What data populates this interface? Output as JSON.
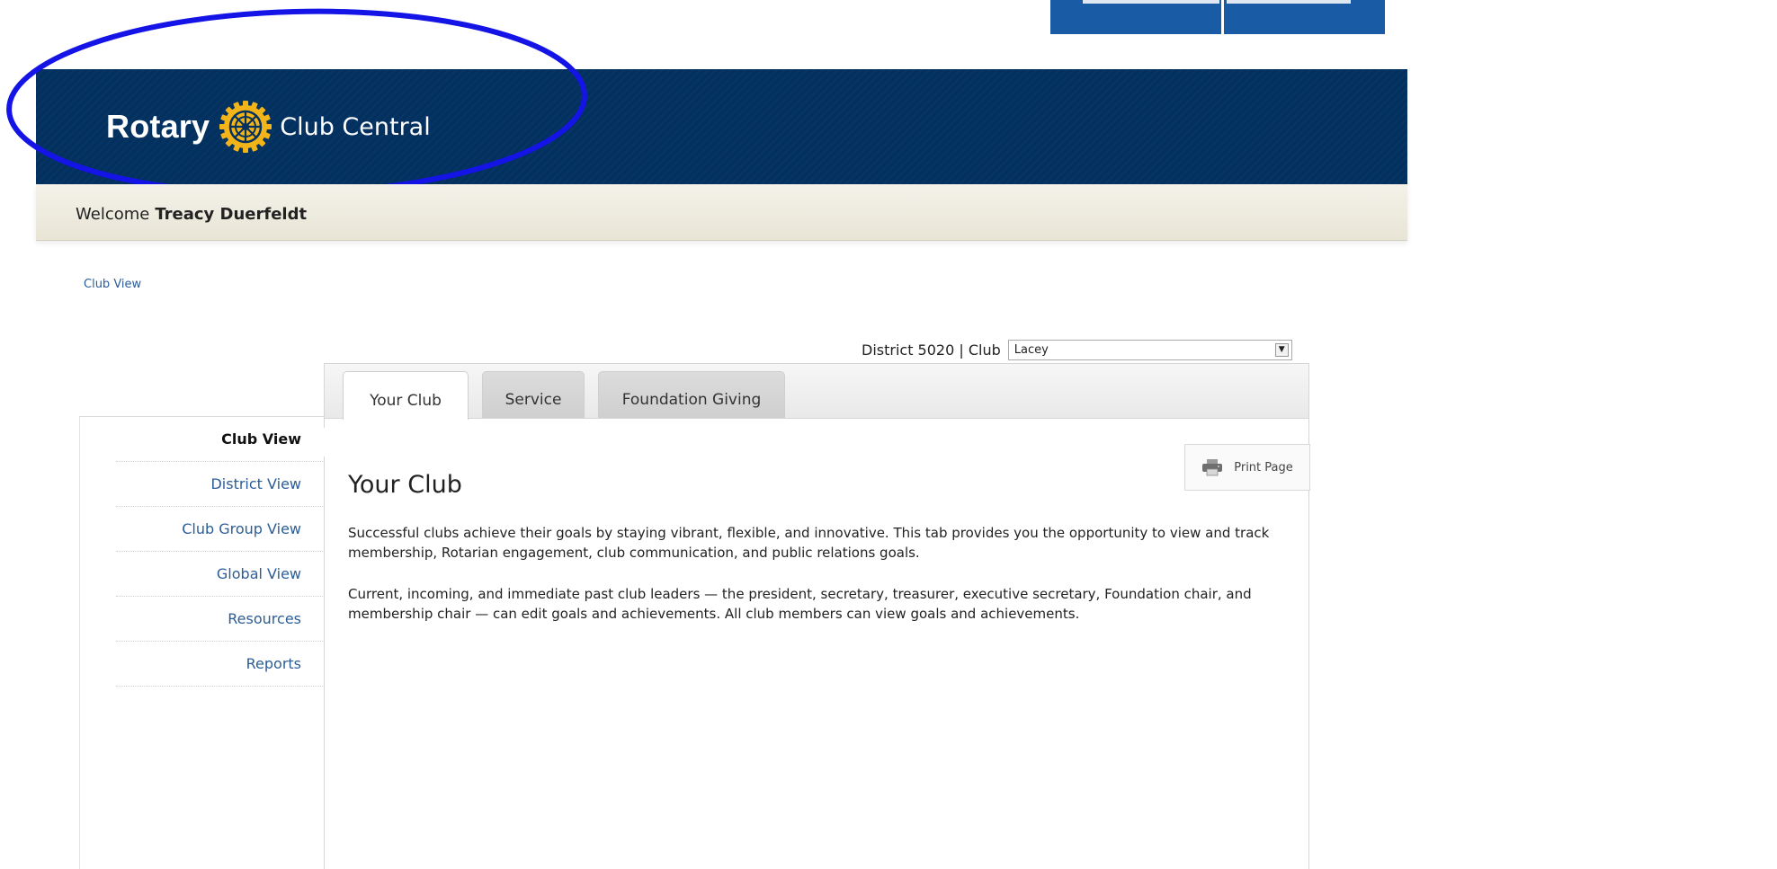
{
  "header": {
    "brand_name": "Rotary",
    "product_name": "Club Central",
    "logo_icon": "rotary-wheel-icon",
    "background_color": "#02305f",
    "emblem_color": "#f2b418"
  },
  "welcome": {
    "label": "Welcome",
    "user_name": "Treacy Duerfeldt"
  },
  "breadcrumb": {
    "current": "Club View"
  },
  "club_selector": {
    "district_label": "District 5020 | Club",
    "selected_club": "Lacey"
  },
  "tabs": [
    {
      "label": "Your Club",
      "active": true
    },
    {
      "label": "Service",
      "active": false
    },
    {
      "label": "Foundation Giving",
      "active": false
    }
  ],
  "print_button": {
    "label": "Print Page",
    "icon": "printer-icon"
  },
  "content": {
    "title": "Your Club",
    "paragraph1": "Successful clubs achieve their goals by staying vibrant, flexible, and innovative. This tab provides you the opportunity to view and track membership, Rotarian engagement, club communication, and public relations goals.",
    "paragraph2": "Current, incoming, and immediate past club leaders — the president, secretary, treasurer, executive secretary, Foundation chair, and membership chair — can edit goals and achievements. All club members can view goals and achievements."
  },
  "sidebar": {
    "items": [
      {
        "label": "Club View",
        "active": true
      },
      {
        "label": "District View",
        "active": false
      },
      {
        "label": "Club Group View",
        "active": false
      },
      {
        "label": "Global View",
        "active": false
      },
      {
        "label": "Resources",
        "active": false
      },
      {
        "label": "Reports",
        "active": false
      }
    ]
  },
  "annotation": {
    "highlight_color": "#1010e0"
  }
}
